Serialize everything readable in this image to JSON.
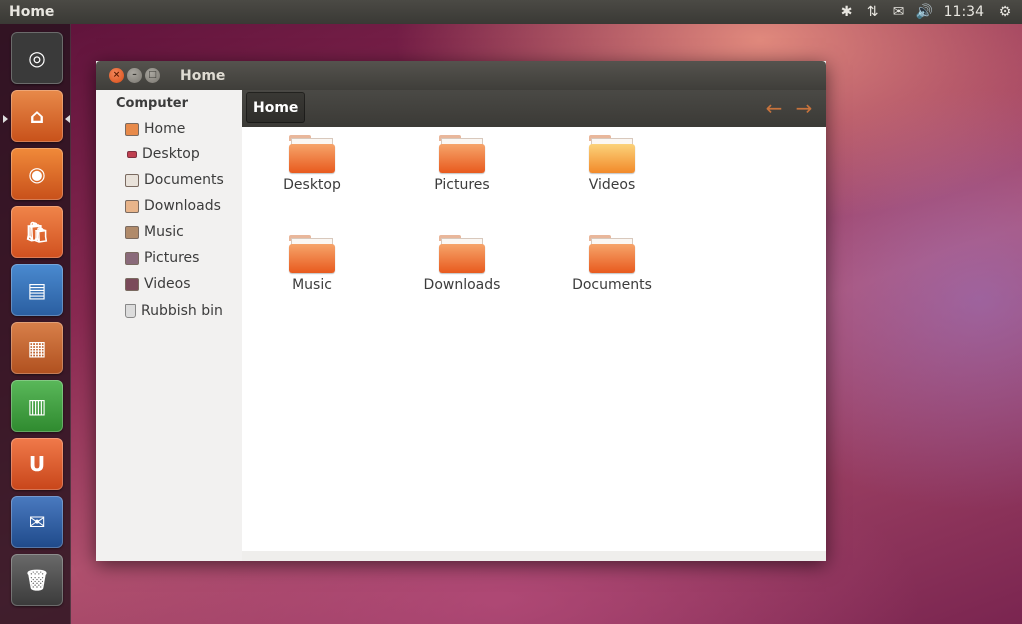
{
  "panel": {
    "title": "Home",
    "clock": "11:34",
    "indicators": [
      {
        "name": "bluetooth-icon",
        "glyph": "✱"
      },
      {
        "name": "network-icon",
        "glyph": "⇅"
      },
      {
        "name": "mail-icon",
        "glyph": "✉"
      },
      {
        "name": "volume-icon",
        "glyph": "🔊"
      }
    ],
    "session_glyph": "⚙"
  },
  "launcher": {
    "items": [
      {
        "name": "ubuntu-dash-icon",
        "glyph": "◎",
        "color": "#3a3a3a"
      },
      {
        "name": "home-folder-icon",
        "glyph": "⌂",
        "color": "#d8662a"
      },
      {
        "name": "firefox-icon",
        "glyph": "◉",
        "color": "#e06a1a"
      },
      {
        "name": "software-centre-icon",
        "glyph": "🛍",
        "color": "#e0652a"
      },
      {
        "name": "writer-icon",
        "glyph": "▤",
        "color": "#2b6fb6"
      },
      {
        "name": "impress-icon",
        "glyph": "▦",
        "color": "#c0632a"
      },
      {
        "name": "calc-icon",
        "glyph": "▥",
        "color": "#3a9a3a"
      },
      {
        "name": "ubuntu-one-icon",
        "glyph": "U",
        "color": "#e0552a"
      },
      {
        "name": "thunderbird-icon",
        "glyph": "✉",
        "color": "#2a5ea0"
      },
      {
        "name": "trash-icon",
        "glyph": "🗑",
        "color": "#555555"
      }
    ]
  },
  "window": {
    "title": "Home",
    "close_glyph": "×",
    "min_glyph": "–",
    "max_glyph": "□"
  },
  "sidebar": {
    "heading": "Computer",
    "items": [
      {
        "label": "Home",
        "icon": "home-icon"
      },
      {
        "label": "Desktop",
        "icon": "desktop-icon"
      },
      {
        "label": "Documents",
        "icon": "documents-icon"
      },
      {
        "label": "Downloads",
        "icon": "downloads-icon"
      },
      {
        "label": "Music",
        "icon": "music-icon"
      },
      {
        "label": "Pictures",
        "icon": "pictures-icon"
      },
      {
        "label": "Videos",
        "icon": "videos-icon"
      },
      {
        "label": "Rubbish bin",
        "icon": "trash-icon"
      }
    ]
  },
  "toolbar": {
    "breadcrumb": "Home",
    "back_glyph": "←",
    "forward_glyph": "→"
  },
  "files": [
    {
      "label": "Desktop"
    },
    {
      "label": "Pictures"
    },
    {
      "label": "Videos"
    },
    {
      "label": "Music"
    },
    {
      "label": "Downloads"
    },
    {
      "label": "Documents"
    }
  ]
}
